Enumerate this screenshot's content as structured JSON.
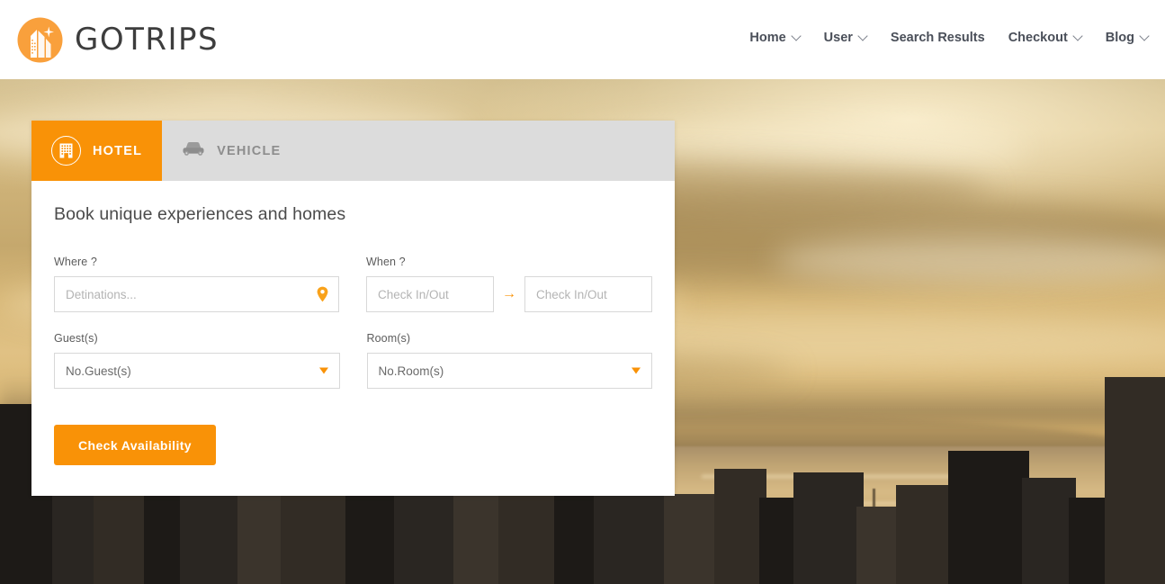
{
  "brand": {
    "name": "GOTRIPS",
    "logo_icon": "buildings-sparkle-logo-icon"
  },
  "nav": {
    "items": [
      {
        "label": "Home",
        "has_dropdown": true
      },
      {
        "label": "User",
        "has_dropdown": true
      },
      {
        "label": "Search Results",
        "has_dropdown": false
      },
      {
        "label": "Checkout",
        "has_dropdown": true
      },
      {
        "label": "Blog",
        "has_dropdown": true
      }
    ]
  },
  "booking": {
    "tabs": [
      {
        "label": "HOTEL",
        "icon": "building-icon",
        "active": true
      },
      {
        "label": "VEHICLE",
        "icon": "car-icon",
        "active": false
      }
    ],
    "title": "Book unique experiences and homes",
    "fields": {
      "where": {
        "label": "Where ?",
        "placeholder": "Detinations...",
        "value": "",
        "icon": "location-pin-icon"
      },
      "when": {
        "label": "When ?",
        "check_in": {
          "placeholder": "Check In/Out",
          "value": ""
        },
        "check_out": {
          "placeholder": "Check In/Out",
          "value": ""
        },
        "separator_icon": "arrow-right-icon",
        "separator_glyph": "→"
      },
      "guests": {
        "label": "Guest(s)",
        "selected": "No.Guest(s)",
        "caret_icon": "chevron-down-icon"
      },
      "rooms": {
        "label": "Room(s)",
        "selected": "No.Room(s)",
        "caret_icon": "chevron-down-icon"
      }
    },
    "submit_label": "Check Availability"
  },
  "colors": {
    "accent_orange": "#f99207",
    "tab_inactive_bg": "#dcdcdc",
    "tab_inactive_text": "#8d8d8d",
    "nav_text": "#4a4f59",
    "card_bg": "#ffffff"
  }
}
